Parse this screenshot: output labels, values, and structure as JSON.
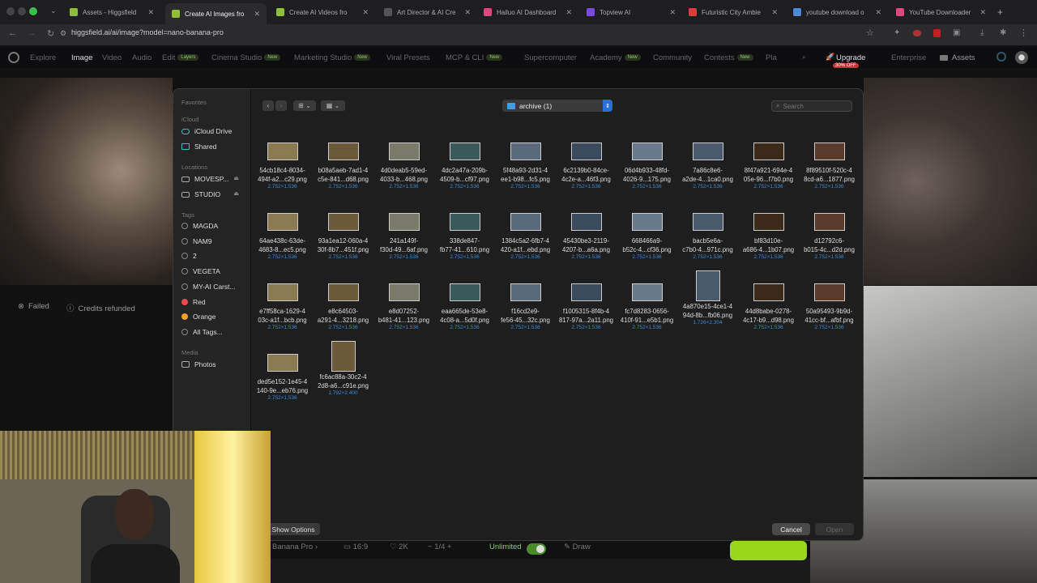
{
  "browser": {
    "tabs": [
      {
        "label": "Assets - Higgsfield",
        "color": "#8fbf3a"
      },
      {
        "label": "Create AI Images fro",
        "color": "#8fbf3a"
      },
      {
        "label": "Create AI Videos fro",
        "color": "#8fbf3a"
      },
      {
        "label": "Art Director & AI Cre",
        "color": "#555555"
      },
      {
        "label": "Hailuo AI Dashboard",
        "color": "#e0457b"
      },
      {
        "label": "Topview AI",
        "color": "#7a4be0"
      },
      {
        "label": "Futuristic City Ambie",
        "color": "#e03a3a"
      },
      {
        "label": "youtube download o",
        "color": "#4a8ad6"
      },
      {
        "label": "YouTube Downloader",
        "color": "#e0457b"
      }
    ],
    "url": "higgsfield.ai/ai/image?model=nano-banana-pro"
  },
  "site_nav": {
    "items": [
      {
        "label": "Explore"
      },
      {
        "label": "Image"
      },
      {
        "label": "Video"
      },
      {
        "label": "Audio"
      },
      {
        "label": "Edit",
        "badge": "Layers"
      },
      {
        "label": "Cinema Studio",
        "badge": "New"
      },
      {
        "label": "Marketing Studio",
        "badge": "New"
      },
      {
        "label": "Viral Presets"
      },
      {
        "label": "MCP & CLI",
        "badge": "New"
      },
      {
        "label": "Supercomputer"
      },
      {
        "label": "Academy",
        "badge": "New"
      },
      {
        "label": "Community"
      },
      {
        "label": "Contests",
        "badge": "New"
      },
      {
        "label": "Pla"
      }
    ],
    "upgrade": "Upgrade",
    "discount": "30% OFF",
    "enterprise": "Enterprise",
    "assets": "Assets"
  },
  "status": {
    "failed": "Failed",
    "refunded": "Credits refunded"
  },
  "bottom_bar": {
    "model": "Banana Pro",
    "ratio": "16:9",
    "resolution": "2K",
    "count": "1/4",
    "unlimited": "Unlimited",
    "draw": "Draw"
  },
  "dialog": {
    "sidebar": {
      "favorites": "Favorites",
      "icloud_head": "iCloud",
      "icloud": [
        {
          "label": "iCloud Drive"
        },
        {
          "label": "Shared"
        }
      ],
      "locations_head": "Locations",
      "locations": [
        {
          "label": "MOVESP..."
        },
        {
          "label": "STUDIO"
        }
      ],
      "tags_head": "Tags",
      "tags": [
        {
          "label": "MAGDA",
          "color": "transparent"
        },
        {
          "label": "NAM9",
          "color": "transparent"
        },
        {
          "label": "2",
          "color": "transparent"
        },
        {
          "label": "VEGETA",
          "color": "transparent"
        },
        {
          "label": "MY-AI Carst...",
          "color": "transparent"
        },
        {
          "label": "Red",
          "color": "#e84a4a"
        },
        {
          "label": "Orange",
          "color": "#f0a030"
        },
        {
          "label": "All Tags...",
          "color": "transparent"
        }
      ],
      "media_head": "Media",
      "media": [
        {
          "label": "Photos"
        }
      ]
    },
    "folder": "archive (1)",
    "search_placeholder": "Search",
    "files": [
      {
        "name1": "54cb18c4-8034-",
        "name2": "494f-a2...c29.png",
        "size": "2.752×1.536",
        "portrait": false
      },
      {
        "name1": "b08a5aeb-7ad1-4",
        "name2": "c5e-841...d68.png",
        "size": "2.752×1.536",
        "portrait": false
      },
      {
        "name1": "4d0deab5-59ed-",
        "name2": "4033-b...468.png",
        "size": "2.752×1.536",
        "portrait": false
      },
      {
        "name1": "4dc2a47a-209b-",
        "name2": "4509-b...cf97.png",
        "size": "2.752×1.536",
        "portrait": false
      },
      {
        "name1": "5f48a93-2d31-4",
        "name2": "ee1-b98...fc5.png",
        "size": "2.752×1.536",
        "portrait": false
      },
      {
        "name1": "6c2139b0-84ce-",
        "name2": "4c2e-a...46f3.png",
        "size": "2.752×1.536",
        "portrait": false
      },
      {
        "name1": "06d4b933-48fd-",
        "name2": "4026-9...175.png",
        "size": "2.752×1.536",
        "portrait": false
      },
      {
        "name1": "7a86c8e6-",
        "name2": "a2de-4...1ca0.png",
        "size": "2.752×1.536",
        "portrait": false
      },
      {
        "name1": "8f47a921-694e-4",
        "name2": "05e-96...f7b0.png",
        "size": "2.752×1.536",
        "portrait": false
      },
      {
        "name1": "8f89510f-520c-4",
        "name2": "8cd-a6...1877.png",
        "size": "2.752×1.536",
        "portrait": false
      },
      {
        "name1": "64ae438c-63de-",
        "name2": "4683-8...ec5.png",
        "size": "2.752×1.536",
        "portrait": false
      },
      {
        "name1": "93a1ea12-060a-4",
        "name2": "30f-8b7...451f.png",
        "size": "2.752×1.536",
        "portrait": false
      },
      {
        "name1": "241a149f-",
        "name2": "f30d-49...6af.png",
        "size": "2.752×1.536",
        "portrait": false
      },
      {
        "name1": "338de847-",
        "name2": "fb77-41...610.png",
        "size": "2.752×1.536",
        "portrait": false
      },
      {
        "name1": "1384c5a2-6fb7-4",
        "name2": "420-a1f...ebd.png",
        "size": "2.752×1.536",
        "portrait": false
      },
      {
        "name1": "45430be3-2119-",
        "name2": "4207-b...a6a.png",
        "size": "2.752×1.536",
        "portrait": false
      },
      {
        "name1": "668466a9-",
        "name2": "b52c-4...cf36.png",
        "size": "2.752×1.536",
        "portrait": false
      },
      {
        "name1": "bacb5e6a-",
        "name2": "c7b0-4...971c.png",
        "size": "2.752×1.536",
        "portrait": false
      },
      {
        "name1": "bf83d10e-",
        "name2": "a686-4...1b07.png",
        "size": "2.752×1.536",
        "portrait": false
      },
      {
        "name1": "d12792c6-",
        "name2": "b015-4c...d2d.png",
        "size": "2.752×1.536",
        "portrait": false
      },
      {
        "name1": "e7ff58ca-1629-4",
        "name2": "03c-a1f...bcb.png",
        "size": "2.752×1.536",
        "portrait": false
      },
      {
        "name1": "e8c64503-",
        "name2": "a291-4...3218.png",
        "size": "2.752×1.536",
        "portrait": false
      },
      {
        "name1": "e8d07252-",
        "name2": "b481-41...123.png",
        "size": "2.752×1.536",
        "portrait": false
      },
      {
        "name1": "eaa665de-53e8-",
        "name2": "4c08-a...5d0f.png",
        "size": "2.752×1.536",
        "portrait": false
      },
      {
        "name1": "f16cd2e9-",
        "name2": "fe56-45...32c.png",
        "size": "2.752×1.536",
        "portrait": false
      },
      {
        "name1": "f1005315-8f4b-4",
        "name2": "817-97a...2a11.png",
        "size": "2.752×1.536",
        "portrait": false
      },
      {
        "name1": "fc7d8283-0656-",
        "name2": "410f-91...e5b1.png",
        "size": "2.752×1.536",
        "portrait": false
      },
      {
        "name1": "4a870e15-4ce1-4",
        "name2": "94d-8b...fb06.png",
        "size": "1.726×2.304",
        "portrait": true
      },
      {
        "name1": "44d8babe-0278-",
        "name2": "4c17-b9...d98.png",
        "size": "2.752×1.536",
        "portrait": false
      },
      {
        "name1": "50a95493-9b9d-",
        "name2": "41cc-bf...afbf.png",
        "size": "2.752×1.536",
        "portrait": false
      },
      {
        "name1": "ded5e152-1e45-4",
        "name2": "140-9e...eb76.png",
        "size": "2.752×1.536",
        "portrait": false
      },
      {
        "name1": "fc6ac88a-30c2-4",
        "name2": "2d8-a6...c91e.png",
        "size": "1.792×2.400",
        "portrait": true
      }
    ],
    "show_options": "Show Options",
    "cancel": "Cancel",
    "open": "Open"
  }
}
